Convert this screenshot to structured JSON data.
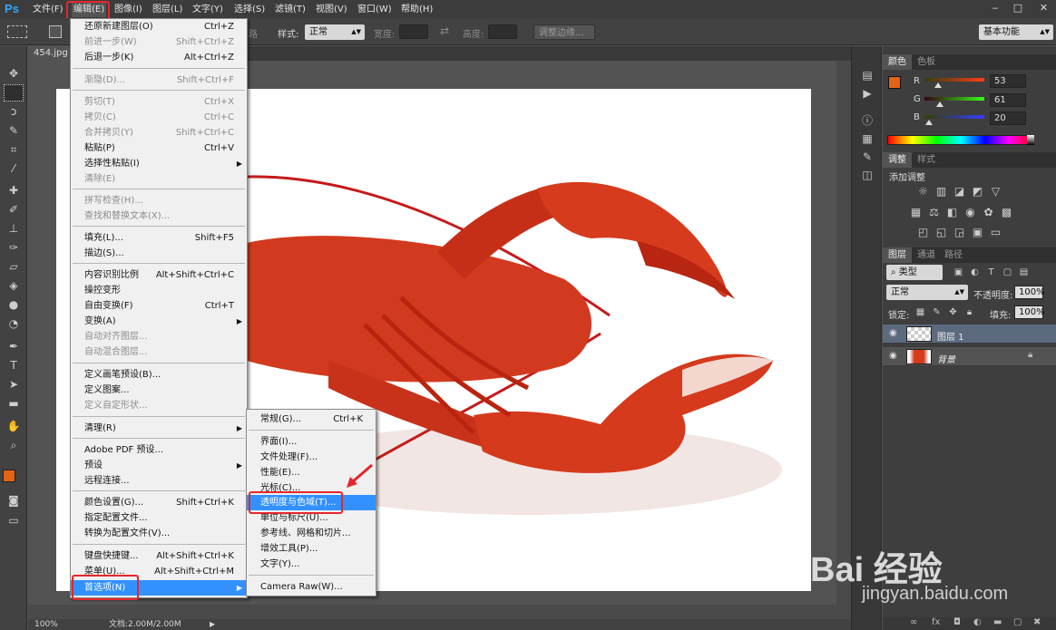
{
  "app": {
    "logo": "Ps"
  },
  "menubar": {
    "items": [
      "文件(F)",
      "编辑(E)",
      "图像(I)",
      "图层(L)",
      "文字(Y)",
      "选择(S)",
      "滤镜(T)",
      "视图(V)",
      "窗口(W)",
      "帮助(H)"
    ]
  },
  "window_controls": {
    "minimize": "‒",
    "restore": "□",
    "close": "✕"
  },
  "options": {
    "feather_tail": "路",
    "style_label": "样式:",
    "style_value": "正常",
    "width_label": "宽度:",
    "height_label": "高度:",
    "refine_edge": "调整边缘...",
    "workspace": "基本功能"
  },
  "document": {
    "tab": "454.jpg"
  },
  "status": {
    "zoom": "100%",
    "doc": "文档:2.00M/2.00M"
  },
  "edit_menu": {
    "items": [
      {
        "label": "还原新建图层(O)",
        "shortcut": "Ctrl+Z",
        "disabled": false
      },
      {
        "label": "前进一步(W)",
        "shortcut": "Shift+Ctrl+Z",
        "disabled": true
      },
      {
        "label": "后退一步(K)",
        "shortcut": "Alt+Ctrl+Z",
        "disabled": false
      },
      {
        "label": "渐隐(D)...",
        "shortcut": "Shift+Ctrl+F",
        "disabled": true
      },
      {
        "label": "剪切(T)",
        "shortcut": "Ctrl+X",
        "disabled": true
      },
      {
        "label": "拷贝(C)",
        "shortcut": "Ctrl+C",
        "disabled": true
      },
      {
        "label": "合并拷贝(Y)",
        "shortcut": "Shift+Ctrl+C",
        "disabled": true
      },
      {
        "label": "粘贴(P)",
        "shortcut": "Ctrl+V",
        "disabled": false
      },
      {
        "label": "选择性粘贴(I)",
        "shortcut": "",
        "disabled": false,
        "submenu": true
      },
      {
        "label": "清除(E)",
        "shortcut": "",
        "disabled": true
      },
      {
        "label": "拼写检查(H)...",
        "shortcut": "",
        "disabled": true
      },
      {
        "label": "查找和替换文本(X)...",
        "shortcut": "",
        "disabled": true
      },
      {
        "label": "填充(L)...",
        "shortcut": "Shift+F5",
        "disabled": false
      },
      {
        "label": "描边(S)...",
        "shortcut": "",
        "disabled": false
      },
      {
        "label": "内容识别比例",
        "shortcut": "Alt+Shift+Ctrl+C",
        "disabled": false
      },
      {
        "label": "操控变形",
        "shortcut": "",
        "disabled": false
      },
      {
        "label": "自由变换(F)",
        "shortcut": "Ctrl+T",
        "disabled": false
      },
      {
        "label": "变换(A)",
        "shortcut": "",
        "disabled": false,
        "submenu": true
      },
      {
        "label": "自动对齐图层...",
        "shortcut": "",
        "disabled": true
      },
      {
        "label": "自动混合图层...",
        "shortcut": "",
        "disabled": true
      },
      {
        "label": "定义画笔预设(B)...",
        "shortcut": "",
        "disabled": false
      },
      {
        "label": "定义图案...",
        "shortcut": "",
        "disabled": false
      },
      {
        "label": "定义自定形状...",
        "shortcut": "",
        "disabled": true
      },
      {
        "label": "清理(R)",
        "shortcut": "",
        "disabled": false,
        "submenu": true
      },
      {
        "label": "Adobe PDF 预设...",
        "shortcut": "",
        "disabled": false
      },
      {
        "label": "预设",
        "shortcut": "",
        "disabled": false,
        "submenu": true
      },
      {
        "label": "远程连接...",
        "shortcut": "",
        "disabled": false
      },
      {
        "label": "颜色设置(G)...",
        "shortcut": "Shift+Ctrl+K",
        "disabled": false
      },
      {
        "label": "指定配置文件...",
        "shortcut": "",
        "disabled": false
      },
      {
        "label": "转换为配置文件(V)...",
        "shortcut": "",
        "disabled": false
      },
      {
        "label": "键盘快捷键...",
        "shortcut": "Alt+Shift+Ctrl+K",
        "disabled": false
      },
      {
        "label": "菜单(U)...",
        "shortcut": "Alt+Shift+Ctrl+M",
        "disabled": false
      },
      {
        "label": "首选项(N)",
        "shortcut": "",
        "disabled": false,
        "submenu": true,
        "highlighted": true
      }
    ]
  },
  "prefs_menu": {
    "items": [
      {
        "label": "常规(G)...",
        "shortcut": "Ctrl+K"
      },
      {
        "label": "界面(I)...",
        "shortcut": ""
      },
      {
        "label": "文件处理(F)...",
        "shortcut": ""
      },
      {
        "label": "性能(E)...",
        "shortcut": ""
      },
      {
        "label": "光标(C)...",
        "shortcut": ""
      },
      {
        "label": "透明度与色域(T)...",
        "shortcut": "",
        "highlighted": true
      },
      {
        "label": "单位与标尺(U)...",
        "shortcut": ""
      },
      {
        "label": "参考线、网格和切片...",
        "shortcut": ""
      },
      {
        "label": "增效工具(P)...",
        "shortcut": ""
      },
      {
        "label": "文字(Y)...",
        "shortcut": ""
      },
      {
        "label": "Camera Raw(W)...",
        "shortcut": ""
      }
    ]
  },
  "color_panel": {
    "tabs": [
      "颜色",
      "色板"
    ],
    "r_label": "R",
    "g_label": "G",
    "b_label": "B",
    "r": "53",
    "g": "61",
    "b": "20",
    "fg": "#e26414",
    "bg": "#353d14"
  },
  "adjust_panel": {
    "tabs": [
      "调整",
      "样式"
    ],
    "title": "添加调整"
  },
  "layers_panel": {
    "tabs": [
      "图层",
      "通道",
      "路径"
    ],
    "filter_label": "类型",
    "blend_mode": "正常",
    "opacity_label": "不透明度:",
    "opacity": "100%",
    "lock_label": "锁定:",
    "fill_label": "填充:",
    "fill": "100%",
    "layers": [
      {
        "name": "图层 1",
        "selected": true
      },
      {
        "name": "背景",
        "selected": false
      }
    ]
  },
  "watermark": {
    "logo": "Bai 经验",
    "url": "jingyan.baidu.com"
  },
  "colors": {
    "accent": "#3391ff",
    "annotation": "#e5262b"
  }
}
